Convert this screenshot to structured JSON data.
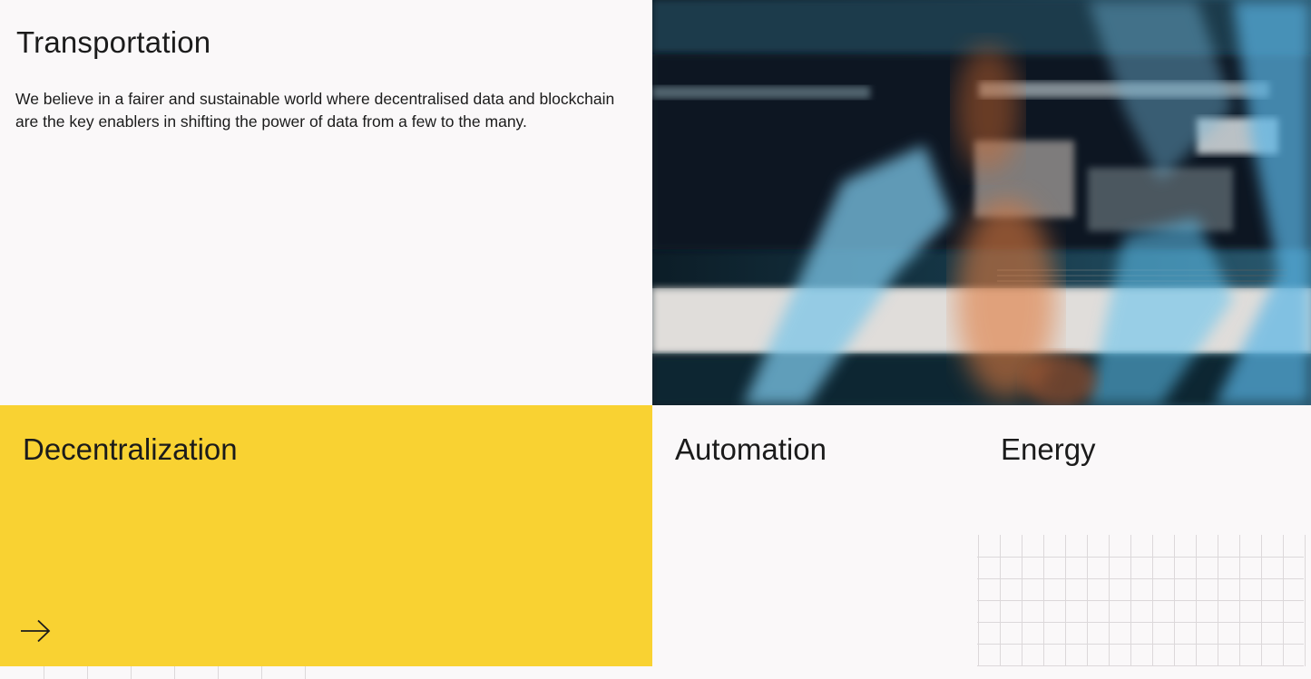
{
  "transportation": {
    "title": "Transportation",
    "description": "We believe in a fairer and sustainable world where decentralised data and blockchain are the key enablers in shifting the power of data from a few to the many."
  },
  "cards": {
    "decentralization": {
      "title": "Decentralization",
      "bg_color": "#f9d232",
      "arrow_icon": "arrow-right-icon"
    },
    "automation": {
      "title": "Automation"
    },
    "energy": {
      "title": "Energy"
    }
  },
  "colors": {
    "page_bg": "#faf8f9",
    "accent_yellow": "#f9d232",
    "text": "#1b1b1b",
    "grid_line": "#dcd8da"
  }
}
